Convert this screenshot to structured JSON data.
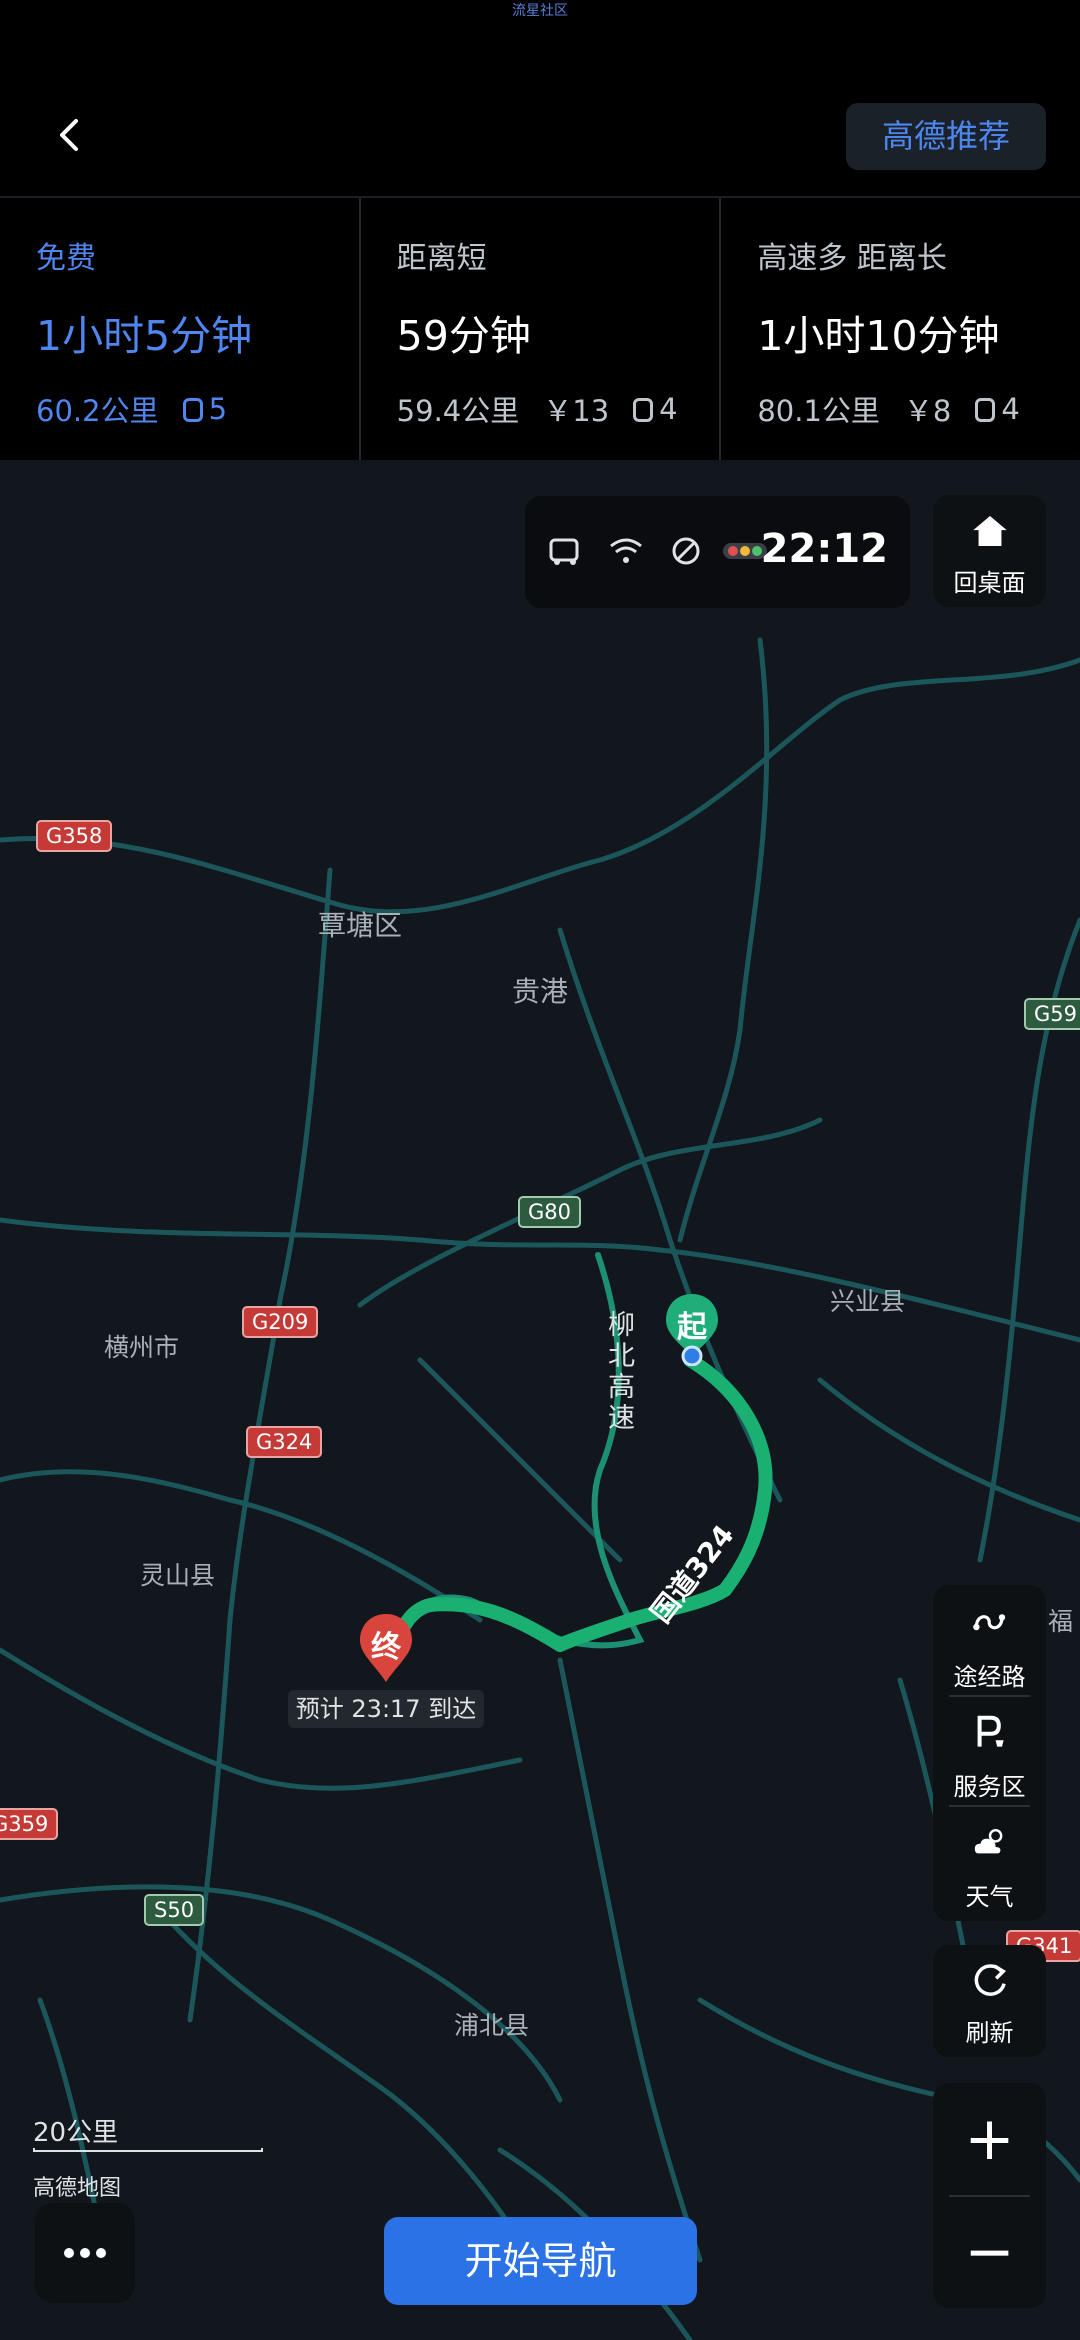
{
  "status_bar": {
    "label": "流星社区"
  },
  "top_bar": {
    "recommend_button": "高德推荐"
  },
  "routes": [
    {
      "tag": "免费",
      "time": "1小时5分钟",
      "distance": "60.2公里",
      "toll": "",
      "lights": "5",
      "active": true
    },
    {
      "tag": "距离短",
      "time": "59分钟",
      "distance": "59.4公里",
      "toll": "￥13",
      "lights": "4",
      "active": false
    },
    {
      "tag": "高速多  距离长",
      "time": "1小时10分钟",
      "distance": "80.1公里",
      "toll": "￥8",
      "lights": "4",
      "active": false
    }
  ],
  "car_status": {
    "time": "22:12"
  },
  "home_button": {
    "label": "回桌面"
  },
  "map": {
    "places": [
      "覃塘区",
      "贵港",
      "横州市",
      "兴业县",
      "灵山县",
      "浦北县",
      "福"
    ],
    "roads": [
      "G358",
      "G80",
      "G209",
      "G324",
      "G59",
      "G359",
      "S50",
      "G341"
    ],
    "road_names": [
      "柳北高速",
      "国道324"
    ],
    "start_label": "起",
    "end_label": "终",
    "eta": "预计 23:17 到达"
  },
  "side_panel": {
    "via_label": "途经路",
    "service_label": "服务区",
    "weather_label": "天气"
  },
  "refresh_button": {
    "label": "刷新"
  },
  "zoom": {
    "in": "+",
    "out": "−"
  },
  "scale": {
    "text": "20公里"
  },
  "brand": "高德地图",
  "start_nav": "开始导航"
}
